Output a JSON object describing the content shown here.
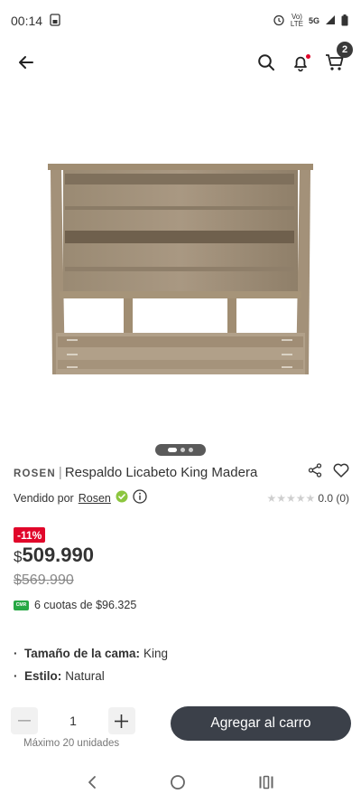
{
  "status_bar": {
    "time": "00:14",
    "network_top": "Vo)",
    "network_bottom": "LTE",
    "signal": "5G"
  },
  "header": {
    "cart_count": "2"
  },
  "product": {
    "brand": "ROSEN",
    "separator": "|",
    "title": "Respaldo Licabeto King Madera",
    "sold_by_label": "Vendido por",
    "seller": "Rosen",
    "rating_text": "0.0 (0)",
    "discount": "-11%",
    "currency": "$",
    "price": "509.990",
    "old_price": "$569.990",
    "installments": "6 cuotas de $96.325",
    "cmr_label": "CMR",
    "specs": [
      {
        "label": "Tamaño de la cama:",
        "value": "King"
      },
      {
        "label": "Estilo:",
        "value": "Natural"
      }
    ]
  },
  "purchase": {
    "quantity": "1",
    "max_units": "Máximo 20 unidades",
    "add_to_cart": "Agregar al carro"
  },
  "colors": {
    "accent_red": "#e1062a",
    "button_dark": "#3b4049",
    "verified_green": "#8cc63f"
  }
}
